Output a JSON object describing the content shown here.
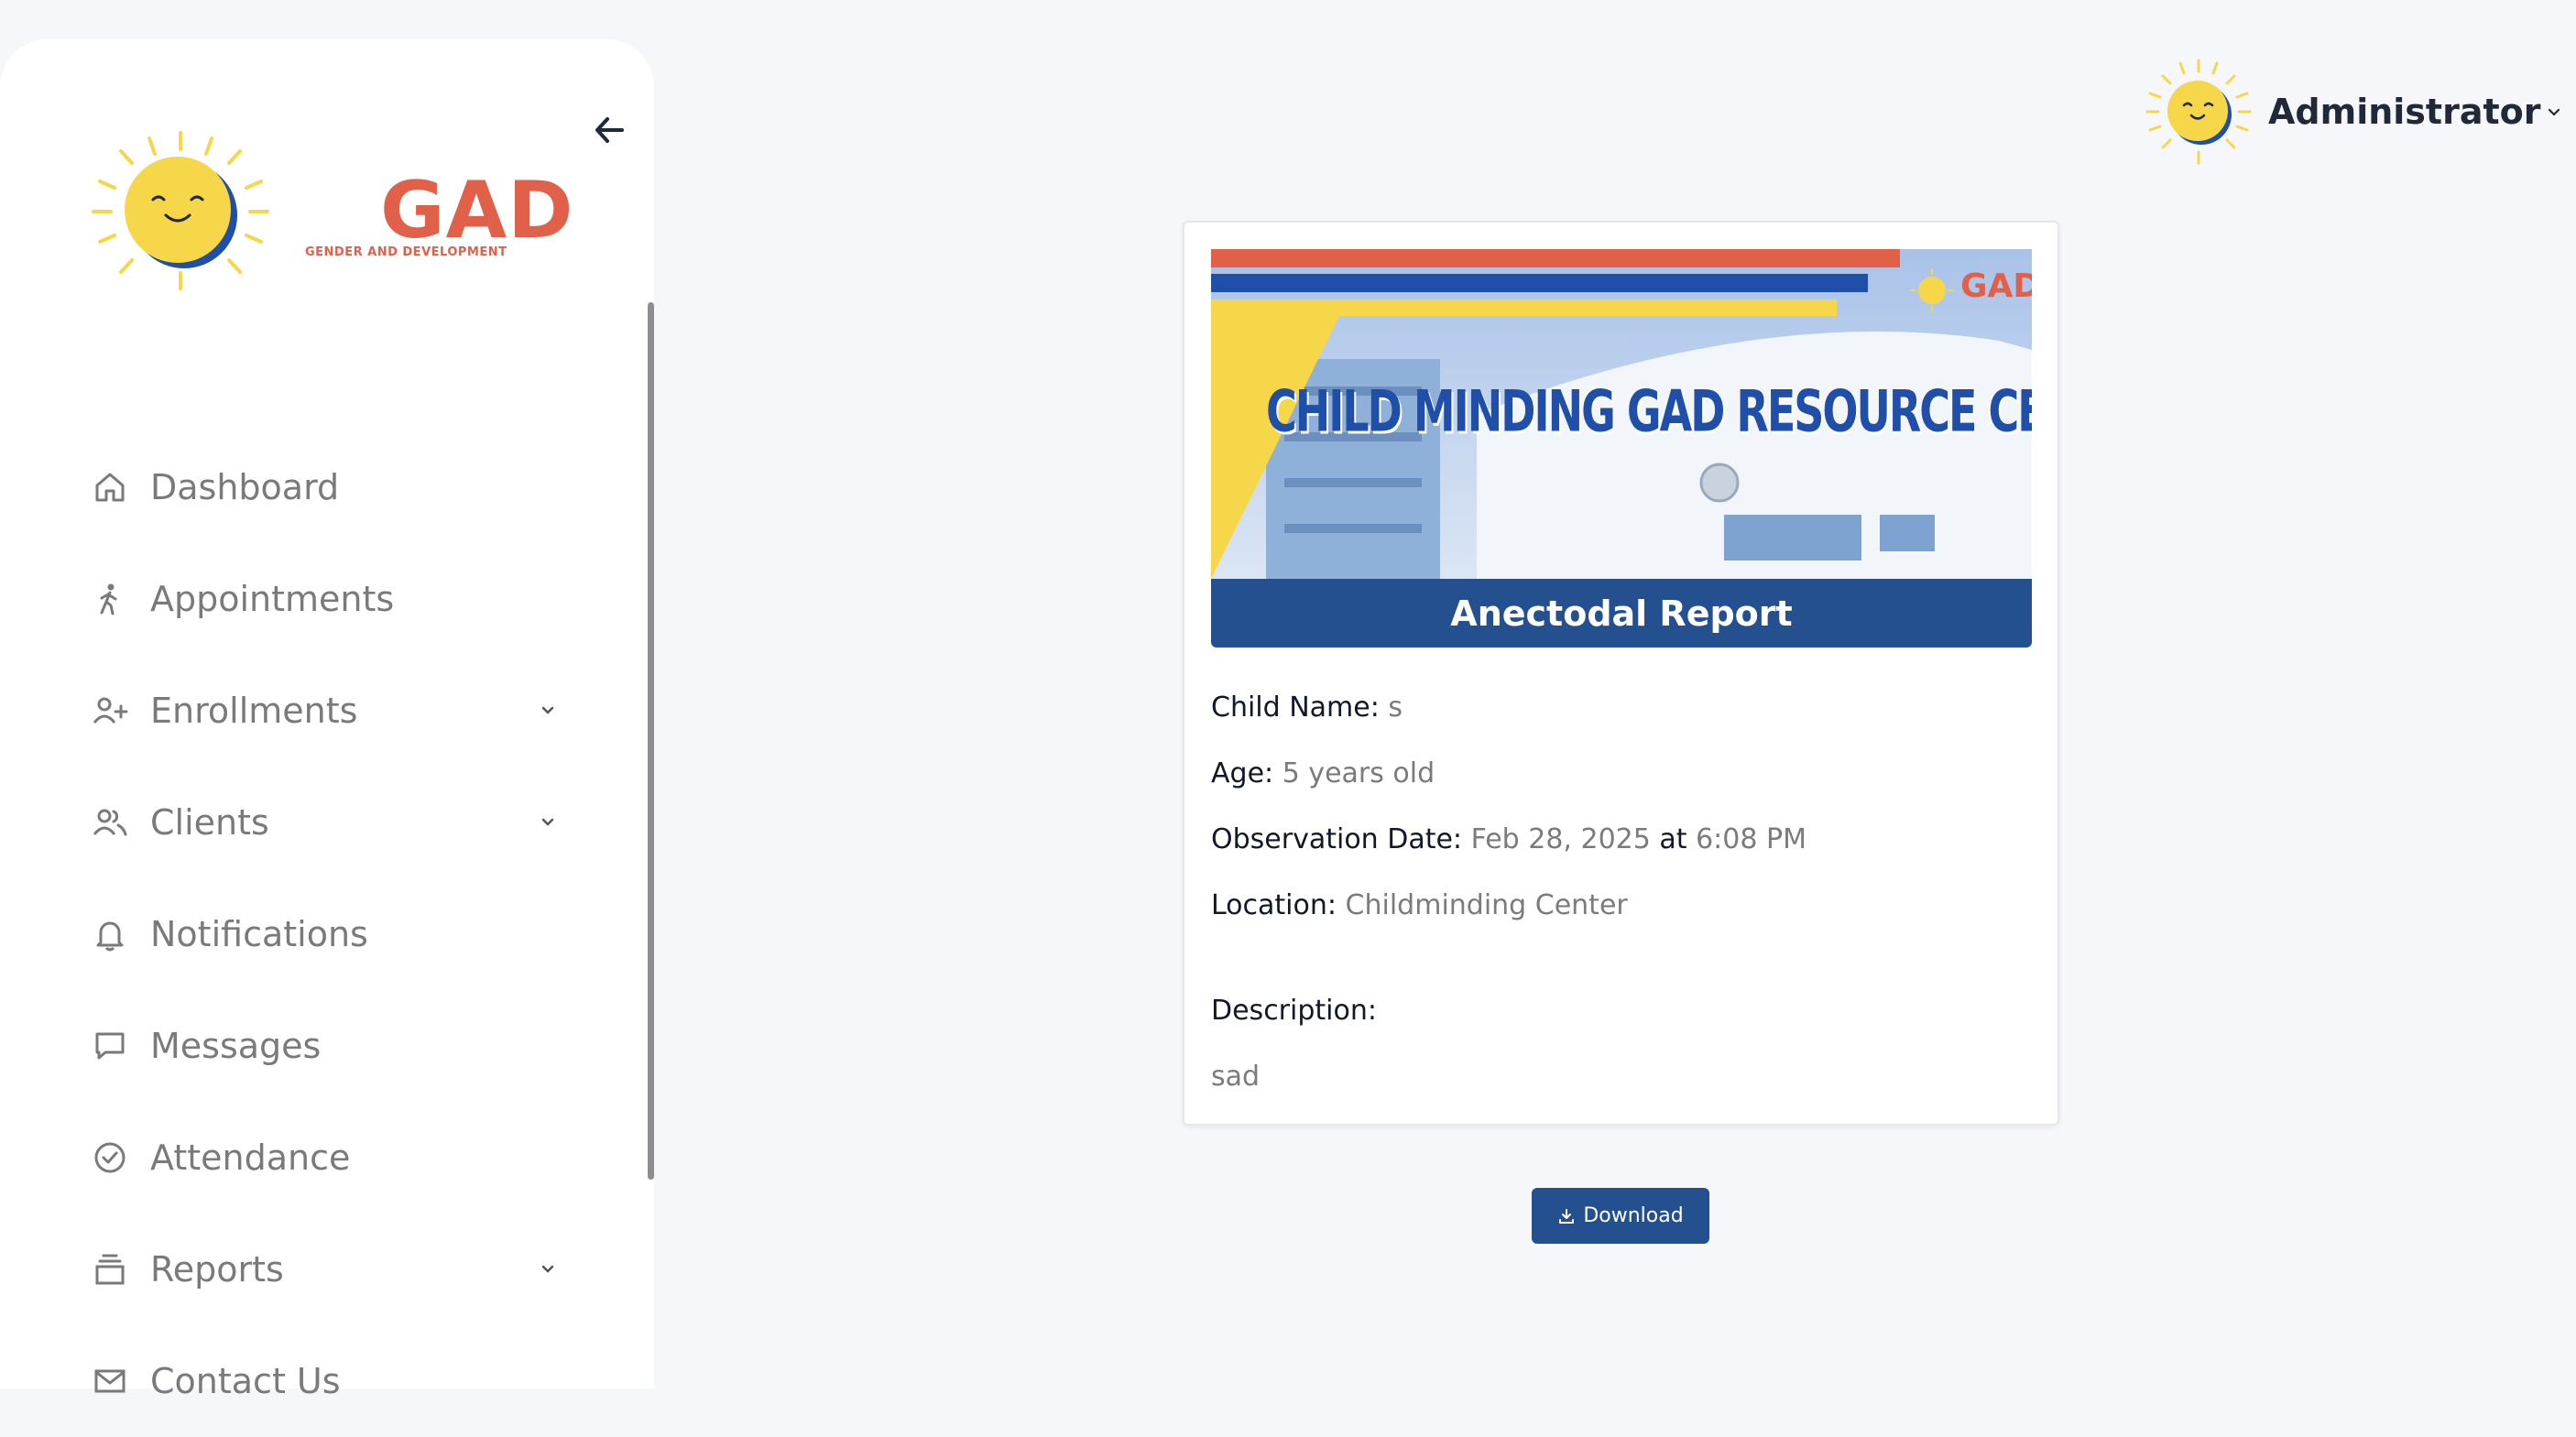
{
  "sidebar": {
    "logo": {
      "text": "GAD",
      "subtitle": "GENDER AND DEVELOPMENT"
    },
    "items": [
      {
        "label": "Dashboard",
        "icon": "home-icon"
      },
      {
        "label": "Appointments",
        "icon": "person-walking-icon"
      },
      {
        "label": "Enrollments",
        "icon": "user-plus-icon",
        "has_submenu": true
      },
      {
        "label": "Clients",
        "icon": "users-icon",
        "has_submenu": true
      },
      {
        "label": "Notifications",
        "icon": "bell-icon"
      },
      {
        "label": "Messages",
        "icon": "message-icon"
      },
      {
        "label": "Attendance",
        "icon": "check-circle-icon"
      },
      {
        "label": "Reports",
        "icon": "reports-icon",
        "has_submenu": true
      },
      {
        "label": "Contact Us",
        "icon": "mail-icon"
      }
    ]
  },
  "header": {
    "user_name": "Administrator"
  },
  "report": {
    "banner_title": "CHILD MINDING GAD RESOURCE CENTER",
    "banner_logo": "GAD",
    "title": "Anectodal Report",
    "child_name_label": "Child Name:",
    "child_name": "s",
    "age_label": "Age:",
    "age": "5 years old",
    "observation_label": "Observation Date:",
    "observation_date": "Feb 28, 2025",
    "observation_at": "at",
    "observation_time": "6:08 PM",
    "location_label": "Location:",
    "location": "Childminding Center",
    "description_label": "Description:",
    "description": "sad"
  },
  "actions": {
    "download_label": "Download"
  },
  "colors": {
    "primary": "#24508f",
    "brand_red": "#e0604a",
    "sun_yellow": "#f7d74a",
    "banner_blue": "#1f4fa8"
  }
}
